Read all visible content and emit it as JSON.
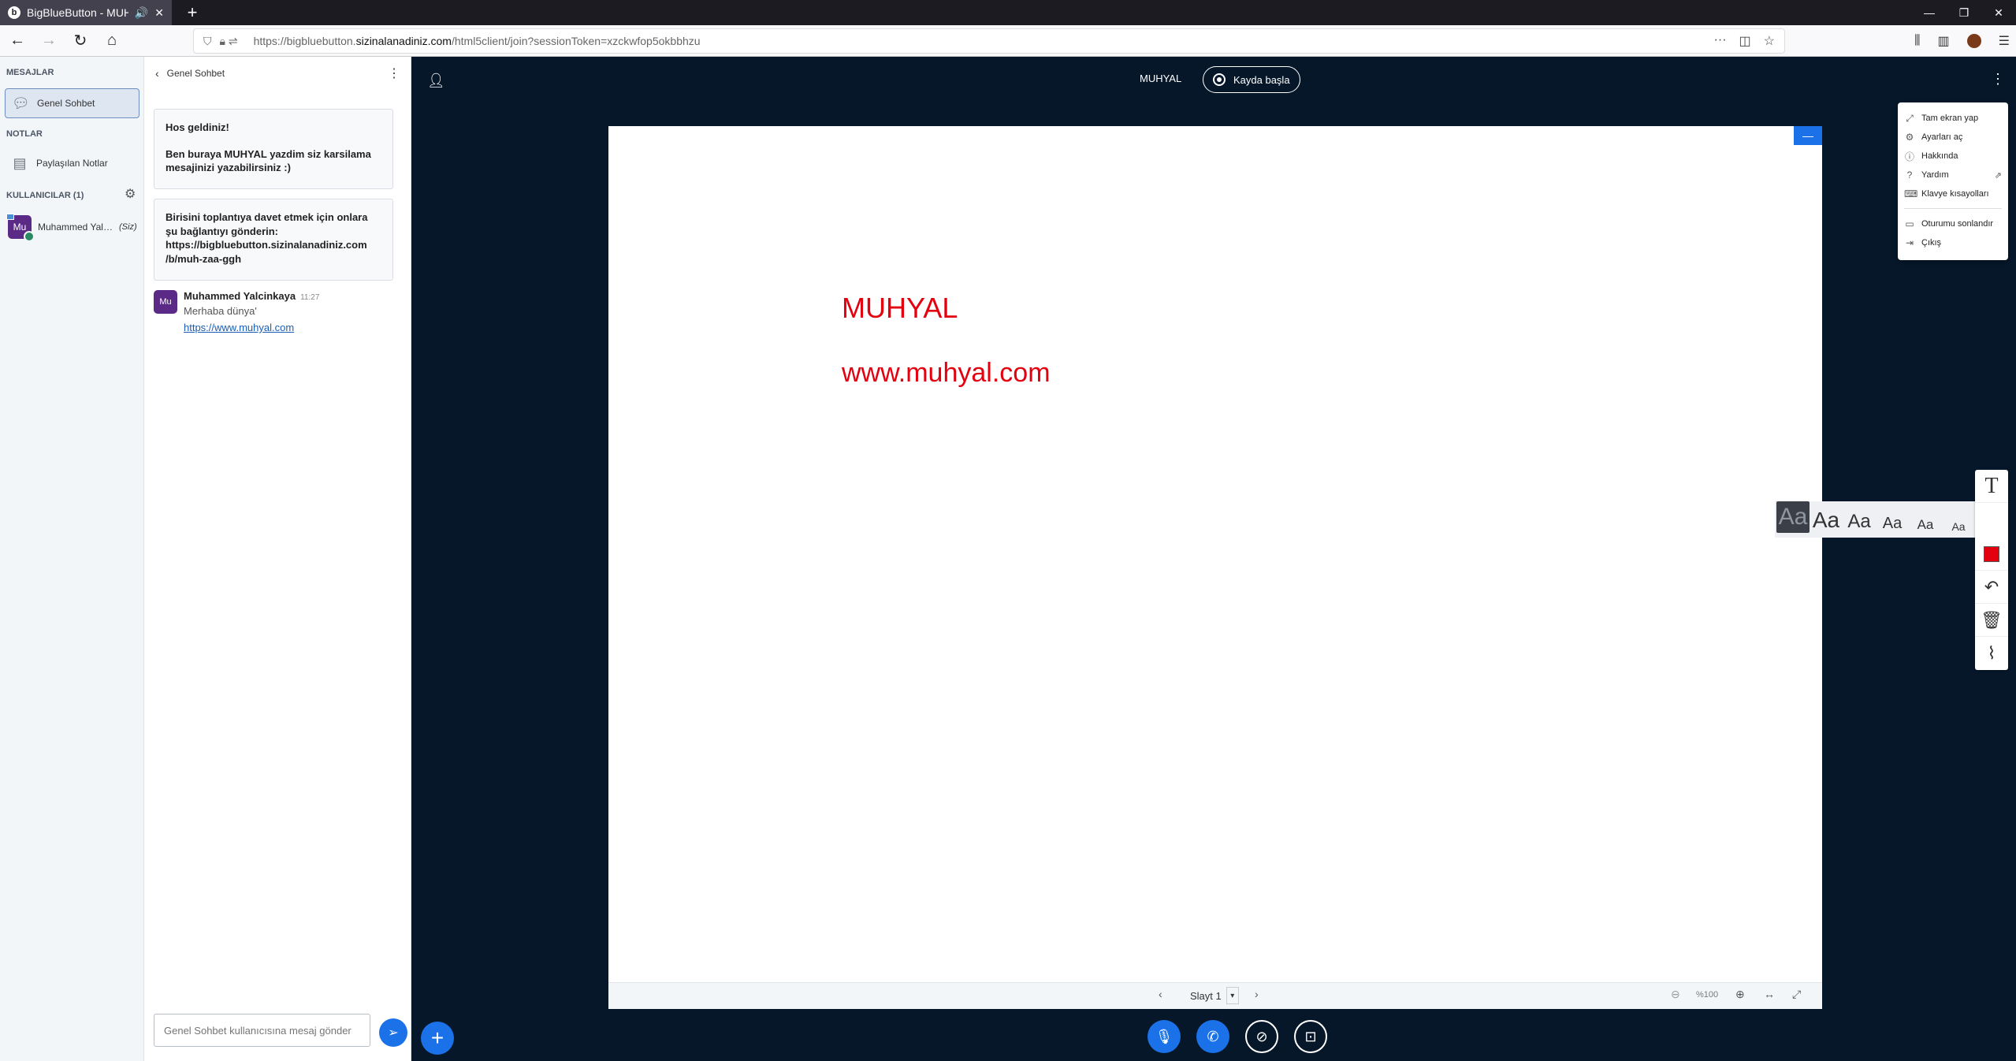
{
  "browser": {
    "tab_title": "BigBlueButton - MUHYAL",
    "url_prefix": "https://bigbluebutton.",
    "url_domain": "sizinalanadiniz.com",
    "url_rest": "/html5client/join?sessionToken=xzckwfop5okbbhzu"
  },
  "sidebar": {
    "messages_header": "MESAJLAR",
    "public_chat": "Genel Sohbet",
    "notes_header": "NOTLAR",
    "shared_notes": "Paylaşılan Notlar",
    "users_header": "KULLANICILAR (1)",
    "user": {
      "initials": "Mu",
      "name": "Muhammed Yalcinkaya",
      "self_label": "(Siz)"
    }
  },
  "chat": {
    "title": "Genel Sohbet",
    "welcome_line1": "Hos geldiniz!",
    "welcome_line2": "Ben buraya MUHYAL yazdim siz karsilama mesajinizi yazabilirsiniz :)",
    "invite_text": "Birisini toplantıya davet etmek için onlara şu bağlantıyı gönderin:",
    "invite_link1": "https://bigbluebutton.sizinalanadiniz.com",
    "invite_link2": "/b/muh-zaa-ggh",
    "message": {
      "initials": "Mu",
      "author": "Muhammed Yalcinkaya",
      "time": "11:27",
      "text": "Merhaba dünya'",
      "link": "https://www.muhyal.com"
    },
    "input_placeholder": "Genel Sohbet kullanıcısına mesaj gönder"
  },
  "main": {
    "meeting_name": "MUHYAL",
    "record_label": "Kayda başla",
    "slide": {
      "line1": "MUHYAL",
      "line2": "www.muhyal.com",
      "slide_label": "Slayt 1",
      "zoom": "%100"
    }
  },
  "options_menu": {
    "items": [
      "Tam ekran yap",
      "Ayarları aç",
      "Hakkında",
      "Yardım",
      "Klavye kısayolları",
      "Oturumu sonlandır",
      "Çıkış"
    ]
  },
  "text_tool": {
    "font_sample": "Aa",
    "tool_glyph": "T",
    "color": "#e3000f"
  },
  "colors": {
    "accent": "#1b72e8",
    "background": "#06172a",
    "avatar": "#5b2a86",
    "slide_text": "#e3000f"
  }
}
